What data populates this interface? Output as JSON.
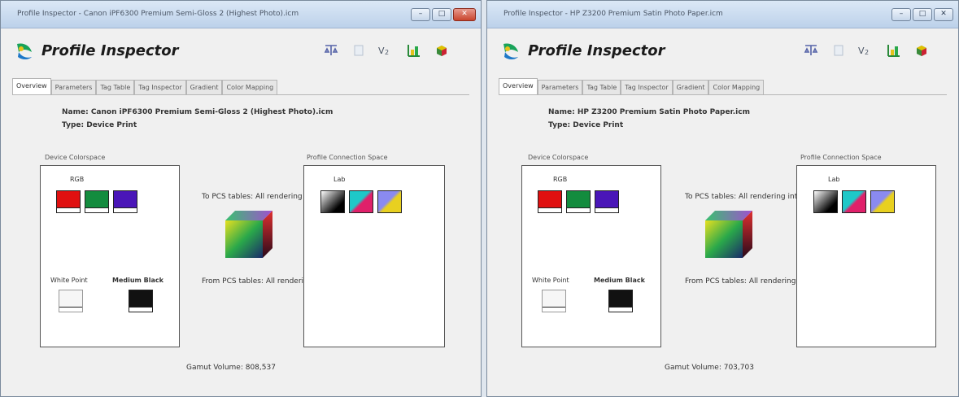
{
  "windows": [
    {
      "title": "Profile Inspector - Canon iPF6300 Premium Semi-Gloss 2 (Highest Photo).icm",
      "app_title": "Profile Inspector",
      "window_buttons": {
        "minimize": "–",
        "maximize": "□",
        "close": "✕"
      },
      "toolbar_icons": [
        "scale-icon",
        "page-icon",
        "vmax-icon",
        "chart-icon",
        "cube-icon"
      ],
      "tabs": [
        "Overview",
        "Parameters",
        "Tag Table",
        "Tag Inspector",
        "Gradient",
        "Color Mapping"
      ],
      "active_tab": 0,
      "name": "Name: Canon iPF6300 Premium Semi-Gloss 2 (Highest Photo).icm",
      "type": "Type: Device Print",
      "device_colorspace_label": "Device Colorspace",
      "device_colorspace_value": "RGB",
      "white_point_label": "White Point",
      "medium_black_label": "Medium Black",
      "pcs_label": "Profile Connection Space",
      "pcs_value": "Lab",
      "input_tables_label": "To PCS tables: All rendering intents",
      "output_tables_label": "From PCS tables: All rendering intents",
      "gamut_volume": "Gamut Volume: 808,537",
      "colors": {
        "red": "#e01010",
        "green": "#138c3e",
        "violet": "#4a16b8"
      }
    },
    {
      "title": "Profile Inspector - HP Z3200 Premium Satin Photo Paper.icm",
      "app_title": "Profile Inspector",
      "window_buttons": {
        "minimize": "–",
        "maximize": "□",
        "close": "✕"
      },
      "toolbar_icons": [
        "scale-icon",
        "page-icon",
        "vmax-icon",
        "chart-icon",
        "cube-icon"
      ],
      "tabs": [
        "Overview",
        "Parameters",
        "Tag Table",
        "Tag Inspector",
        "Gradient",
        "Color Mapping"
      ],
      "active_tab": 0,
      "name": "Name: HP Z3200 Premium Satin Photo Paper.icm",
      "type": "Type: Device Print",
      "device_colorspace_label": "Device Colorspace",
      "device_colorspace_value": "RGB",
      "white_point_label": "White Point",
      "medium_black_label": "Medium Black",
      "pcs_label": "Profile Connection Space",
      "pcs_value": "Lab",
      "input_tables_label": "To PCS tables: All rendering intents",
      "output_tables_label": "From PCS tables: All rendering intents",
      "gamut_volume": "Gamut Volume: 703,703",
      "colors": {
        "red": "#e01010",
        "green": "#138c3e",
        "violet": "#4a16b8"
      }
    }
  ]
}
